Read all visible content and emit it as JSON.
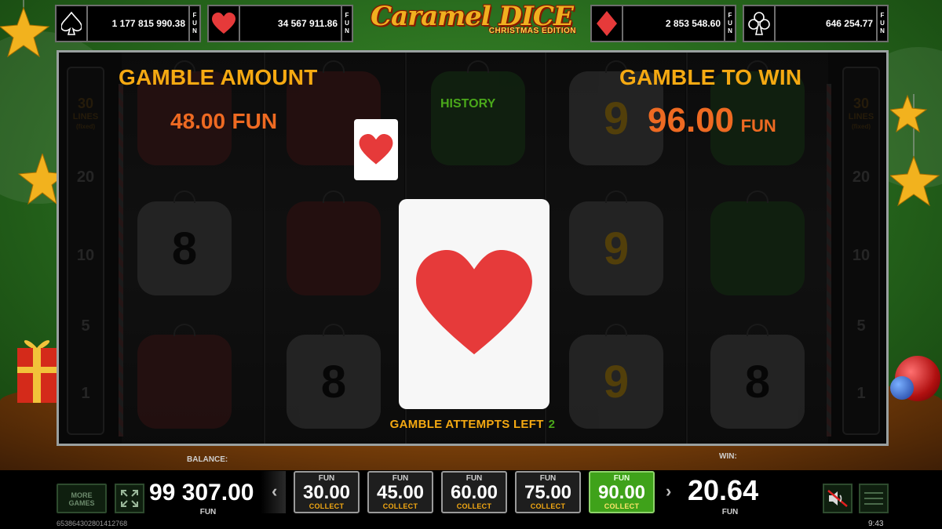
{
  "title": {
    "main": "Caramel DICE",
    "sub": "CHRISTMAS EDITION"
  },
  "jackpots": [
    {
      "suit": "spade-icon",
      "value": "1 177 815 990.38",
      "currency": "FUN"
    },
    {
      "suit": "heart-icon",
      "value": "34 567 911.86",
      "currency": "FUN"
    },
    {
      "suit": "diamond-icon",
      "value": "2 853 548.60",
      "currency": "FUN"
    },
    {
      "suit": "club-icon",
      "value": "646 254.77",
      "currency": "FUN"
    }
  ],
  "reels": {
    "lines_badge": {
      "count": "30",
      "label": "LINES",
      "sub": "(fixed)"
    },
    "line_markers": [
      "20",
      "10",
      "5",
      "1"
    ]
  },
  "gamble": {
    "amount_label": "GAMBLE AMOUNT",
    "amount_value": "48.00",
    "amount_currency": "FUN",
    "to_win_label": "GAMBLE TO WIN",
    "to_win_value": "96.00",
    "to_win_currency": "FUN",
    "history_label": "HISTORY",
    "history_cards": [
      "heart"
    ],
    "current_card": "heart",
    "attempts_label": "GAMBLE ATTEMPTS LEFT",
    "attempts_left": "2"
  },
  "bottom_bar": {
    "more_games": "MORE GAMES",
    "balance_label": "BALANCE:",
    "balance_value": "99 307.00",
    "balance_currency": "FUN",
    "bets": [
      {
        "currency": "FUN",
        "value": "30.00",
        "action": "COLLECT",
        "active": false
      },
      {
        "currency": "FUN",
        "value": "45.00",
        "action": "COLLECT",
        "active": false
      },
      {
        "currency": "FUN",
        "value": "60.00",
        "action": "COLLECT",
        "active": false
      },
      {
        "currency": "FUN",
        "value": "75.00",
        "action": "COLLECT",
        "active": false
      },
      {
        "currency": "FUN",
        "value": "90.00",
        "action": "COLLECT",
        "active": true
      }
    ],
    "win_label": "WIN:",
    "win_value": "20.64",
    "win_currency": "FUN",
    "session_id": "653864302801412768",
    "clock": "9:43"
  },
  "colors": {
    "accent_gold": "#f5a912",
    "accent_orange": "#ee6a22",
    "accent_green": "#4aa81a",
    "heart_red": "#e63a3a"
  }
}
